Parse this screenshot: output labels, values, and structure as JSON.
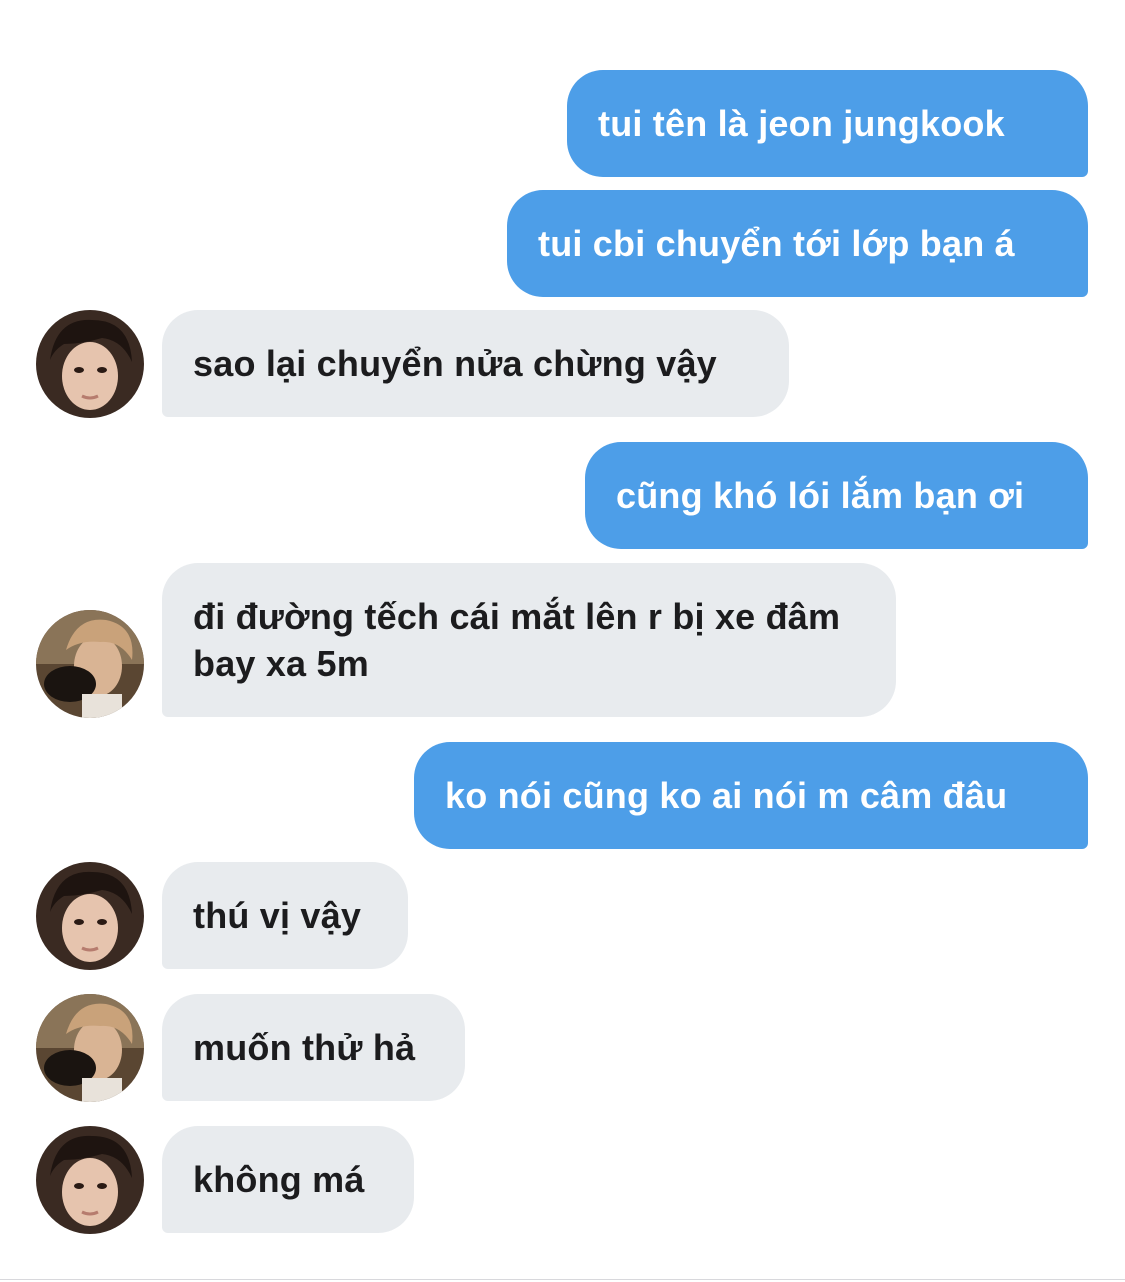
{
  "messages": [
    {
      "side": "sent",
      "text": "tui tên là jeon jungkook"
    },
    {
      "side": "sent",
      "text": "tui cbi chuyển tới lớp bạn á"
    },
    {
      "side": "received",
      "avatar": "avatar-a",
      "text": "sao lại chuyển nửa chừng vậy"
    },
    {
      "side": "sent",
      "text": "cũng khó lói lắm bạn ơi"
    },
    {
      "side": "received",
      "avatar": "avatar-b",
      "text": "đi đường tếch cái mắt lên r bị xe đâm bay xa 5m"
    },
    {
      "side": "sent",
      "text": "ko nói cũng ko ai nói m câm đâu"
    },
    {
      "side": "received",
      "avatar": "avatar-a",
      "text": "thú vị vậy"
    },
    {
      "side": "received",
      "avatar": "avatar-b",
      "text": "muốn thử hả"
    },
    {
      "side": "received",
      "avatar": "avatar-a",
      "text": "không má"
    }
  ],
  "colors": {
    "sent_bubble": "#4d9ee8",
    "received_bubble": "#e8ebee",
    "received_text": "#1c1c1e",
    "sent_text": "#ffffff"
  }
}
